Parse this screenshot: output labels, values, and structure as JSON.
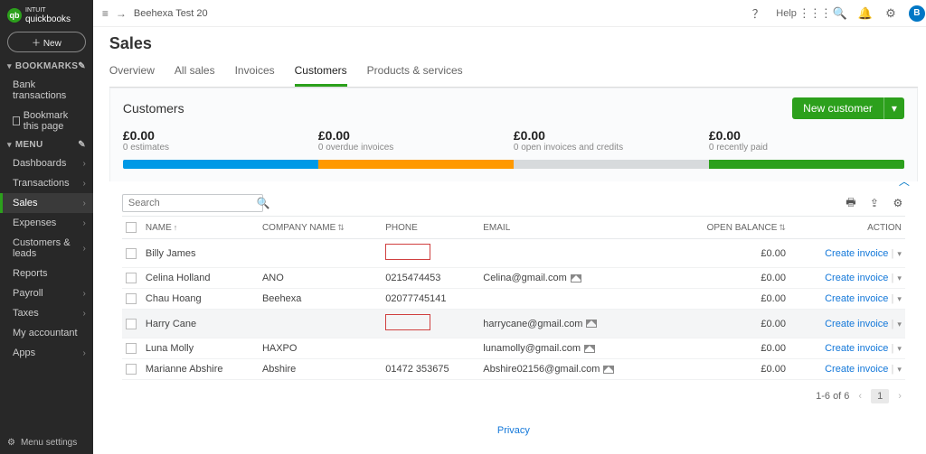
{
  "brand": {
    "sup": "INTUIT",
    "name": "quickbooks",
    "badge": "qb"
  },
  "new_btn": "＋   New",
  "bookmarks_label": "BOOKMARKS",
  "bookmarks": [
    {
      "label": "Bank transactions"
    },
    {
      "label": "Bookmark this page",
      "icon": true
    }
  ],
  "menu_label": "MENU",
  "menu": [
    {
      "label": "Dashboards"
    },
    {
      "label": "Transactions"
    },
    {
      "label": "Sales",
      "active": true
    },
    {
      "label": "Expenses"
    },
    {
      "label": "Customers & leads"
    },
    {
      "label": "Reports",
      "nochev": true
    },
    {
      "label": "Payroll"
    },
    {
      "label": "Taxes"
    },
    {
      "label": "My accountant",
      "nochev": true
    },
    {
      "label": "Apps"
    }
  ],
  "menu_settings": "Menu settings",
  "topbar": {
    "company": "Beehexa Test 20",
    "help": "Help",
    "avatar": "B"
  },
  "page_title": "Sales",
  "tabs": [
    "Overview",
    "All sales",
    "Invoices",
    "Customers",
    "Products & services"
  ],
  "active_tab": 3,
  "panel": {
    "title": "Customers",
    "new_customer": "New customer",
    "stats": [
      {
        "amount": "£0.00",
        "label": "0 estimates"
      },
      {
        "amount": "£0.00",
        "label": "0 overdue invoices"
      },
      {
        "amount": "£0.00",
        "label": "0 open invoices and credits"
      },
      {
        "amount": "£0.00",
        "label": "0 recently paid"
      }
    ]
  },
  "search_placeholder": "Search",
  "columns": {
    "name": "NAME",
    "company": "COMPANY NAME",
    "phone": "PHONE",
    "email": "EMAIL",
    "balance": "OPEN BALANCE",
    "action": "ACTION"
  },
  "rows": [
    {
      "name": "Billy James",
      "company": "",
      "phone": "",
      "email": "",
      "balance": "£0.00",
      "red": true
    },
    {
      "name": "Celina Holland",
      "company": "ANO",
      "phone": "0215474453",
      "email": "Celina@gmail.com",
      "balance": "£0.00",
      "envelope": true
    },
    {
      "name": "Chau Hoang",
      "company": "Beehexa",
      "phone": "02077745141",
      "email": "",
      "balance": "£0.00"
    },
    {
      "name": "Harry Cane",
      "company": "",
      "phone": "",
      "email": "harrycane@gmail.com",
      "balance": "£0.00",
      "red": true,
      "hl": true,
      "envelope": true
    },
    {
      "name": "Luna Molly",
      "company": "HAXPO",
      "phone": "",
      "email": "lunamolly@gmail.com",
      "balance": "£0.00",
      "envelope": true
    },
    {
      "name": "Marianne Abshire",
      "company": "Abshire",
      "phone": "01472 353675",
      "email": "Abshire02156@gmail.com",
      "balance": "£0.00",
      "envelope": true
    }
  ],
  "row_action": "Create invoice",
  "pager": {
    "range": "1-6 of 6",
    "page": "1"
  },
  "privacy": "Privacy"
}
